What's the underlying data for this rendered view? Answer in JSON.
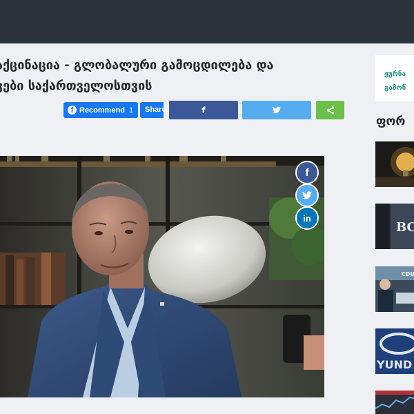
{
  "article": {
    "title_line1": "აქცინაცია - გლობალური გამოცდილება და",
    "title_line2": "ვები საქართველოსთვის"
  },
  "social_bar": {
    "recommend_label": "Recommend",
    "recommend_count": "1",
    "share_label": "Share",
    "facebook_icon": "facebook-icon",
    "twitter_icon": "twitter-icon",
    "share_icon": "share-icon"
  },
  "floating_share": {
    "facebook_glyph": "f",
    "linkedin_glyph": "in"
  },
  "sidebar": {
    "box_line1": "ჟურნა",
    "box_line2": "გამოწ",
    "heading": "ფორ",
    "thumb_text_2": "BC",
    "thumb_text_3": "CDU",
    "thumb_text_4": "YUND"
  },
  "colors": {
    "topbar": "#2b333c",
    "facebook": "#3b5998",
    "twitter": "#55acee",
    "share": "#6cc04a",
    "accent_teal": "#1d8f86"
  }
}
